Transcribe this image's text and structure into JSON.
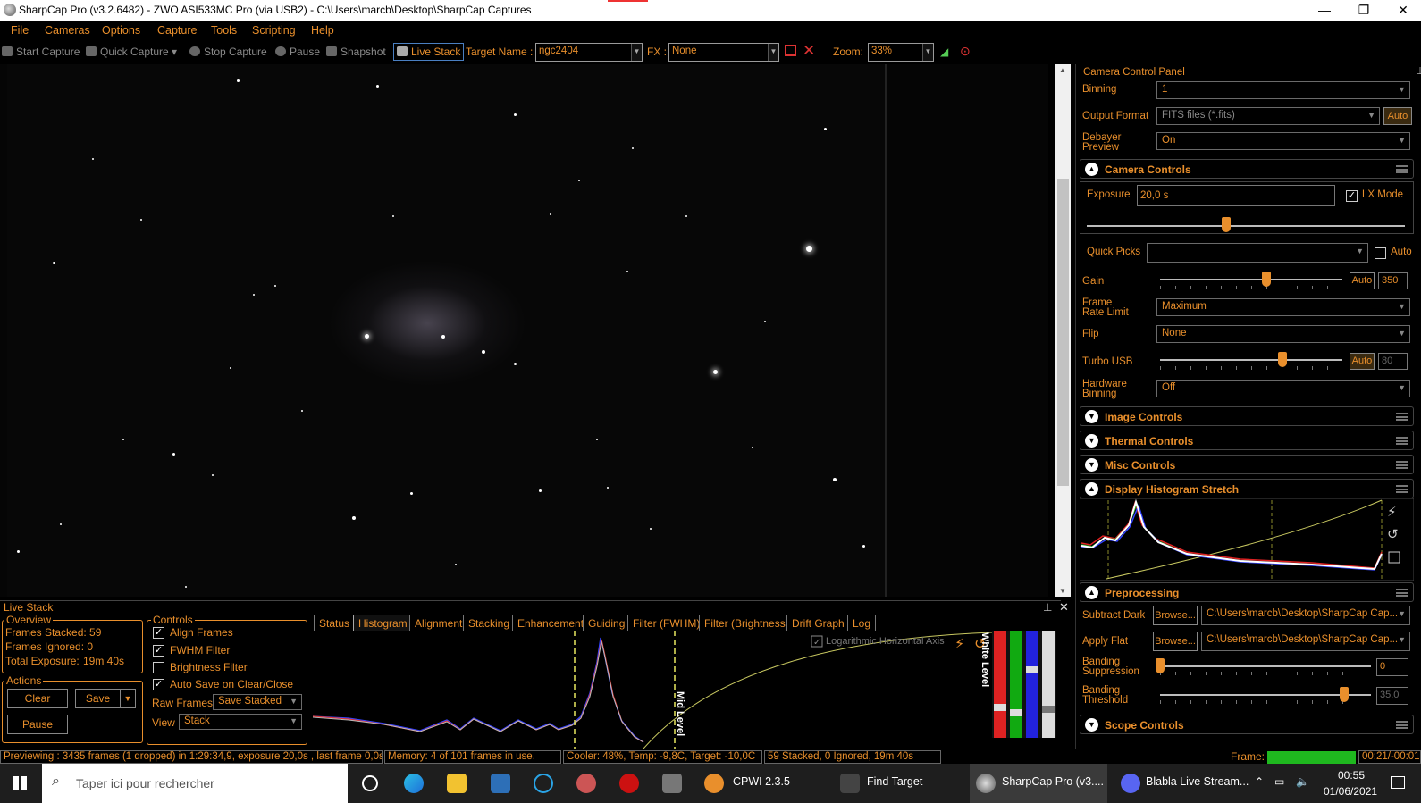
{
  "window": {
    "title": "SharpCap Pro (v3.2.6482) - ZWO ASI533MC Pro (via USB2) - C:\\Users\\marcb\\Desktop\\SharpCap Captures",
    "minimize": "—",
    "maximize": "❐",
    "close": "✕"
  },
  "menu": [
    "File",
    "Cameras",
    "Options",
    "Capture",
    "Tools",
    "Scripting",
    "Help"
  ],
  "toolbar": {
    "start_capture": "Start Capture",
    "quick_capture": "Quick Capture",
    "stop_capture": "Stop Capture",
    "pause": "Pause",
    "snapshot": "Snapshot",
    "live_stack": "Live Stack",
    "target_name_label": "Target Name :",
    "target_name": "ngc2404",
    "fx_label": "FX :",
    "fx": "None",
    "zoom_label": "Zoom:",
    "zoom": "33%"
  },
  "panel": {
    "title": "Camera Control Panel",
    "binning_label": "Binning",
    "binning": "1",
    "output_format_label": "Output Format",
    "output_format": "FITS files (*.fits)",
    "auto_label": "Auto",
    "debayer_label": "Debayer Preview",
    "debayer": "On",
    "camera_controls": "Camera Controls",
    "exposure_label": "Exposure",
    "exposure": "20,0 s",
    "lx_mode": "LX Mode",
    "lx_mode_checked": true,
    "quick_picks_label": "Quick Picks",
    "quick_picks": "",
    "quick_auto": "Auto",
    "gain_label": "Gain",
    "gain_auto": "Auto",
    "gain": "350",
    "frame_rate_label": "Frame Rate Limit",
    "frame_rate": "Maximum",
    "flip_label": "Flip",
    "flip": "None",
    "turbo_label": "Turbo USB",
    "turbo_auto": "Auto",
    "turbo": "80",
    "hw_binning_label": "Hardware Binning",
    "hw_binning": "Off",
    "image_controls": "Image Controls",
    "thermal_controls": "Thermal Controls",
    "misc_controls": "Misc Controls",
    "histogram_stretch": "Display Histogram Stretch",
    "preprocessing": "Preprocessing",
    "subtract_dark_label": "Subtract Dark",
    "browse": "Browse...",
    "subtract_dark_path": "C:\\Users\\marcb\\Desktop\\SharpCap Cap...",
    "apply_flat_label": "Apply Flat",
    "apply_flat_path": "C:\\Users\\marcb\\Desktop\\SharpCap Cap...",
    "banding_supp_label": "Banding Suppression",
    "banding_supp": "0",
    "banding_thresh_label": "Banding Threshold",
    "banding_thresh": "35,0",
    "scope_controls": "Scope Controls"
  },
  "live": {
    "title": "Live Stack",
    "overview": "Overview",
    "frames_stacked": "Frames Stacked: 59",
    "frames_ignored": "Frames Ignored:  0",
    "total_exposure_label": "Total Exposure:",
    "total_exposure": "19m 40s",
    "actions": "Actions",
    "clear": "Clear",
    "save": "Save",
    "pause": "Pause",
    "controls": "Controls",
    "align": "Align Frames",
    "fwhm": "FWHM Filter",
    "brightness": "Brightness Filter",
    "autosave": "Auto Save on Clear/Close",
    "raw_frames_label": "Raw Frames",
    "raw_frames": "Save Stacked",
    "view_label": "View",
    "view": "Stack",
    "tabs": [
      "Status",
      "Histogram",
      "Alignment",
      "Stacking",
      "Enhancement",
      "Guiding",
      "Filter (FWHM)",
      "Filter (Brightness)",
      "Drift Graph",
      "Log"
    ],
    "active_tab": "Histogram",
    "log_axis": "Logarithmic Horizontal Axis",
    "mid_level": "Mid Level",
    "white_level": "White Level"
  },
  "status": {
    "preview": "Previewing : 3435 frames (1 dropped) in 1:29:34,9, exposure 20,0s , last frame 0,0s",
    "memory": "Memory: 4 of 101 frames in use.",
    "cooler": "Cooler: 48%, Temp: -9,8C, Target: -10,0C",
    "stacked": "59 Stacked, 0 Ignored, 19m 40s",
    "frame_label": "Frame:",
    "frame_time": "00:21/-00:01"
  },
  "taskbar": {
    "search": "Taper ici pour rechercher",
    "cpwi": "CPWI 2.3.5",
    "find_target": "Find Target",
    "sharpcap": "SharpCap Pro (v3....",
    "blabla": "Blabla Live Stream...",
    "time": "00:55",
    "date": "01/06/2021"
  }
}
